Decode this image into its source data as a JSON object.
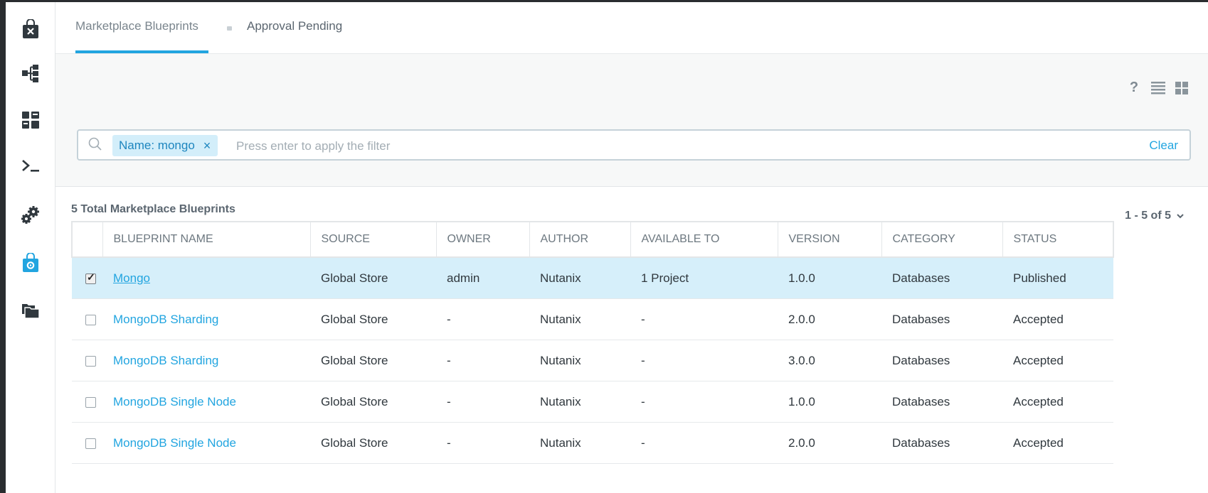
{
  "sidebar": {
    "items": [
      {
        "name": "marketplace-bag-icon"
      },
      {
        "name": "blueprints-tree-icon"
      },
      {
        "name": "apps-grid-icon"
      },
      {
        "name": "terminal-icon"
      },
      {
        "name": "settings-gears-icon"
      },
      {
        "name": "marketplace-manager-icon",
        "active": true
      },
      {
        "name": "folders-icon"
      }
    ]
  },
  "tabs": {
    "active": "Marketplace Blueprints",
    "second": "Approval Pending"
  },
  "toolbar": {
    "help": "?"
  },
  "filter": {
    "chip": "Name: mongo",
    "chip_close": "×",
    "placeholder": "Press enter to apply the filter",
    "clear": "Clear"
  },
  "summary": {
    "total": "5 Total Marketplace Blueprints",
    "pager": "1 - 5 of 5"
  },
  "table": {
    "headers": [
      "BLUEPRINT NAME",
      "SOURCE",
      "OWNER",
      "AUTHOR",
      "AVAILABLE TO",
      "VERSION",
      "CATEGORY",
      "STATUS"
    ],
    "rows": [
      {
        "checked": true,
        "name": "Mongo",
        "source": "Global Store",
        "owner": "admin",
        "author": "Nutanix",
        "available": "1 Project",
        "version": "1.0.0",
        "category": "Databases",
        "status": "Published"
      },
      {
        "checked": false,
        "name": "MongoDB Sharding",
        "source": "Global Store",
        "owner": "-",
        "author": "Nutanix",
        "available": "-",
        "version": "2.0.0",
        "category": "Databases",
        "status": "Accepted"
      },
      {
        "checked": false,
        "name": "MongoDB Sharding",
        "source": "Global Store",
        "owner": "-",
        "author": "Nutanix",
        "available": "-",
        "version": "3.0.0",
        "category": "Databases",
        "status": "Accepted"
      },
      {
        "checked": false,
        "name": "MongoDB Single Node",
        "source": "Global Store",
        "owner": "-",
        "author": "Nutanix",
        "available": "-",
        "version": "1.0.0",
        "category": "Databases",
        "status": "Accepted"
      },
      {
        "checked": false,
        "name": "MongoDB Single Node",
        "source": "Global Store",
        "owner": "-",
        "author": "Nutanix",
        "available": "-",
        "version": "2.0.0",
        "category": "Databases",
        "status": "Accepted"
      }
    ]
  },
  "colors": {
    "accent": "#22a5e0",
    "selected_row": "#d6effa",
    "sidebar_icon": "#30383e"
  }
}
